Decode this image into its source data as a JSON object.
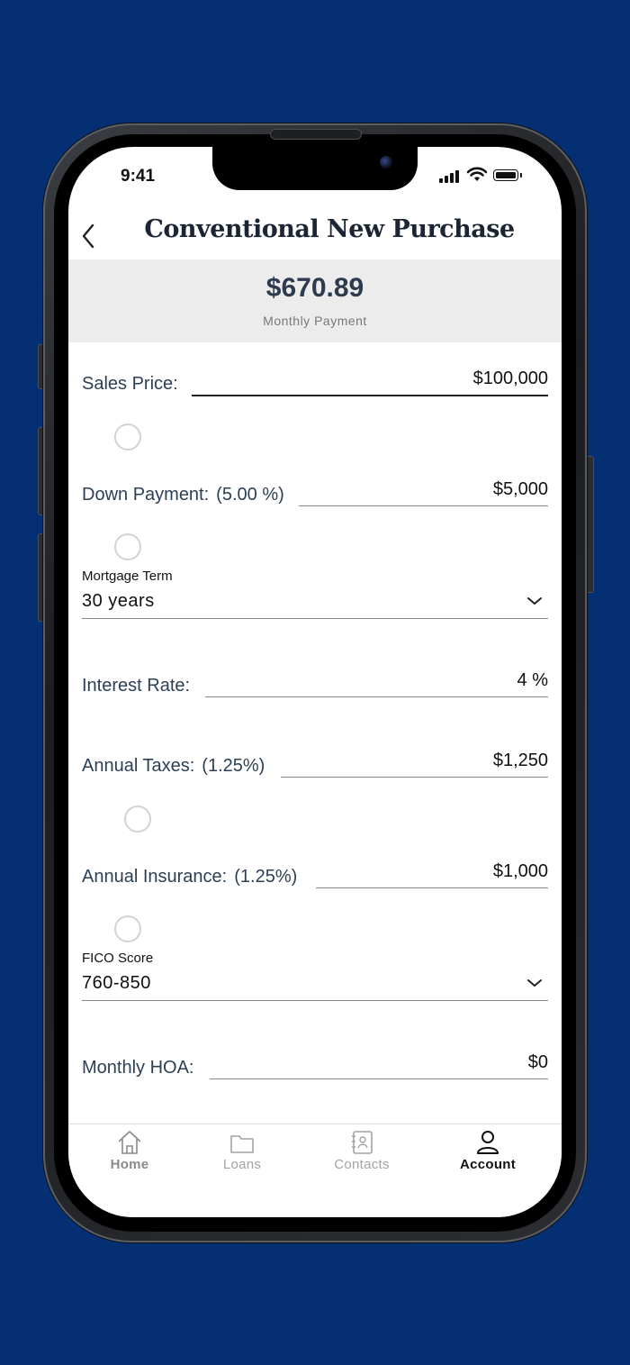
{
  "status_bar": {
    "time": "9:41"
  },
  "header": {
    "title": "Conventional New Purchase",
    "back_icon": "chevron-left-icon"
  },
  "summary": {
    "amount": "$670.89",
    "label": "Monthly Payment"
  },
  "form": {
    "sales_price": {
      "label": "Sales Price:",
      "value": "$100,000"
    },
    "down_payment": {
      "label": "Down Payment:",
      "percent": "(5.00 %)",
      "value": "$5,000"
    },
    "mortgage_term": {
      "label": "Mortgage Term",
      "value": "30 years"
    },
    "interest_rate": {
      "label": "Interest Rate:",
      "value": "4 %"
    },
    "annual_taxes": {
      "label": "Annual Taxes:",
      "percent": "(1.25%)",
      "value": "$1,250"
    },
    "annual_insurance": {
      "label": "Annual Insurance:",
      "percent": "(1.25%)",
      "value": "$1,000"
    },
    "fico_score": {
      "label": "FICO Score",
      "value": "760-850"
    },
    "monthly_hoa": {
      "label": "Monthly HOA:",
      "value": "$0"
    }
  },
  "tabs": [
    {
      "label": "Home",
      "icon": "home-icon",
      "color": "#8a8a8a"
    },
    {
      "label": "Loans",
      "icon": "folder-icon",
      "color": "#a3a3a3"
    },
    {
      "label": "Contacts",
      "icon": "contacts-book-icon",
      "color": "#a3a3a3"
    },
    {
      "label": "Account",
      "icon": "person-icon",
      "color": "#111111",
      "active": true
    }
  ],
  "colors": {
    "background": "#042f72",
    "label_text": "#2d3f55",
    "summary_bg": "#ececec"
  }
}
